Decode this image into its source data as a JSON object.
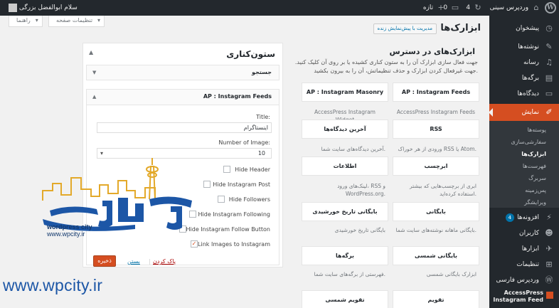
{
  "adminbar": {
    "site_name": "وردپرس سینی",
    "updates_count": "4",
    "comments_count": "0",
    "new_label": "تازه",
    "howdy": "سلام ابوالفضل بزرگی",
    "icons": [
      "wordpress-logo-icon",
      "home-icon",
      "update-icon",
      "comment-icon",
      "plus-icon"
    ]
  },
  "sidebar": {
    "items": [
      {
        "label": "پیشخوان",
        "icon": "dashboard-icon"
      },
      {
        "label": "نوشته‌ها",
        "icon": "pin-icon"
      },
      {
        "label": "رسانه",
        "icon": "media-icon"
      },
      {
        "label": "برگه‌ها",
        "icon": "page-icon"
      },
      {
        "label": "دیدگاه‌ها",
        "icon": "comment-icon"
      },
      {
        "label": "نمایش",
        "icon": "brush-icon"
      },
      {
        "label": "افزونه‌ها",
        "icon": "plugin-icon",
        "badge": "4"
      },
      {
        "label": "کاربران",
        "icon": "user-icon"
      },
      {
        "label": "ابزارها",
        "icon": "wrench-icon"
      },
      {
        "label": "تنظیمات",
        "icon": "settings-icon"
      },
      {
        "label": "وردپرس فارسی",
        "icon": "wordpress-icon"
      }
    ],
    "submenu": [
      "پوسته‌ها",
      "سفارشی‌سازی",
      "ابزارک‌ها",
      "فهرست‌ها",
      "سربرگ",
      "پس‌زمینه",
      "ویرایشگر"
    ],
    "plugin_item": "AccessPress Instagram Feed",
    "active_color": "#d54e21"
  },
  "screen_meta": {
    "options": "تنظیمات صفحه",
    "help": "راهنما"
  },
  "page": {
    "title": "ابزارک‌ها",
    "manage_button": "مدیریت با پیش‌نمایش زنده"
  },
  "available": {
    "title": "ابزارک‌های در دسترس",
    "description": "جهت فعال سازی ابزارک آن را به ستون کناری کشیده یا بر روی آن کلیک کنید. جهت غیرفعال کردن ابزارک و حذف تنظیماتش، آن را به بیرون بکشید.",
    "widgets": [
      {
        "title": "AP : Instagram Feeds",
        "desc": "AccessPress Instagram Feeds"
      },
      {
        "title": "AP : Instagram Masonry",
        "desc": "AccessPress Instagram Widget"
      },
      {
        "title": "RSS",
        "desc": "ورودی از هر خوراک RSS یا Atom."
      },
      {
        "title": "آخرین دیدگاه‌ها",
        "desc": "آخرین دیدگاه‌های سایت شما."
      },
      {
        "title": "ابرچسب",
        "desc": "ابری از برچسب‌هایی که بیشتر استفاده کرده‌اید."
      },
      {
        "title": "اطلاعات",
        "desc": "لینک‌های ورود، RSS و WordPress.org."
      },
      {
        "title": "بایگانی",
        "desc": "بایگانی ماهانه نوشته‌های سایت شما."
      },
      {
        "title": "بایگانی تاریخ خورشیدی",
        "desc": "بایگانی تاریخ خورشیدی"
      },
      {
        "title": "بایگانی شمسی",
        "desc": "ابزارک بایگانی شمسی"
      },
      {
        "title": "برگه‌ها",
        "desc": "فهرستی از برگه‌های سایت شما."
      },
      {
        "title": "تقویم",
        "desc": ""
      },
      {
        "title": "تقویم شمسی",
        "desc": ""
      }
    ]
  },
  "area": {
    "title": "ستون‌کناری",
    "search_widget": "جستجو",
    "instagram_widget": "AP : Instagram Feeds",
    "form": {
      "title_label": "Title:",
      "title_value": "اینستاگرام",
      "number_label": "Number of Image:",
      "number_value": "10",
      "checkboxes": [
        {
          "label": "Hide Header",
          "checked": false
        },
        {
          "label": "Hide Instagram Post",
          "checked": false
        },
        {
          "label": "Hide Followers",
          "checked": false
        },
        {
          "label": "Hide Instagram Following",
          "checked": false
        },
        {
          "label": "Hide Instagram Follow Button",
          "checked": false
        },
        {
          "label": "Link Images to Instagram",
          "checked": true
        }
      ],
      "save": "ذخیره",
      "delete": "پاک کردن",
      "close": "بستن"
    }
  },
  "watermark": {
    "url": "www.wpcity.ir",
    "brand": "wordpress city",
    "brand_url": "www.wpcity.ir",
    "logo_text": "وردپرس سیتی",
    "color": "#1c56a6"
  }
}
